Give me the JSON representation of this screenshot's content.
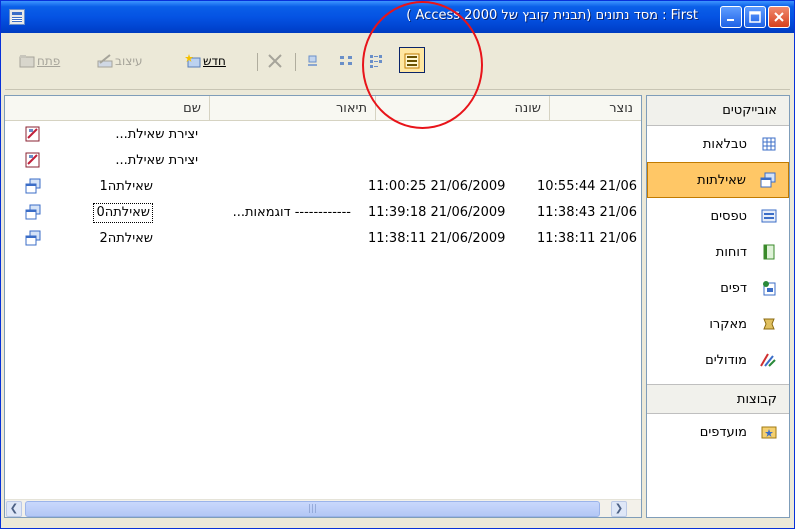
{
  "window": {
    "title": "First : מסד נתונים (תבנית קובץ של Access 2000 )",
    "accent_color": "#0553e3",
    "close_color": "#d7401d"
  },
  "toolbar": {
    "open_label": "פתח",
    "design_label": "עיצוב",
    "new_label": "חדש",
    "delete_icon": "delete-x-icon",
    "view_icons": [
      "large-icons-icon",
      "small-icons-icon",
      "list-view-icon",
      "details-view-icon"
    ],
    "active_view": "details-view-icon"
  },
  "objects_panel": {
    "header": "אובייקטים",
    "items": [
      {
        "label": "טבלאות",
        "icon": "table-icon"
      },
      {
        "label": "שאילתות",
        "icon": "query-icon",
        "selected": true
      },
      {
        "label": "טפסים",
        "icon": "form-icon"
      },
      {
        "label": "דוחות",
        "icon": "report-icon"
      },
      {
        "label": "דפים",
        "icon": "page-icon"
      },
      {
        "label": "מאקרו",
        "icon": "macro-icon"
      },
      {
        "label": "מודולים",
        "icon": "module-icon"
      }
    ],
    "groups_header": "קבוצות",
    "groups": [
      {
        "label": "מועדפים",
        "icon": "favorites-icon"
      }
    ]
  },
  "list": {
    "columns": [
      "שם",
      "תיאור",
      "שונה",
      "נוצר"
    ],
    "rows": [
      {
        "name": "יצירת שאילת...",
        "description": "",
        "modified": "",
        "created": "",
        "icon": "wizard-icon"
      },
      {
        "name": "יצירת שאילת...",
        "description": "",
        "modified": "",
        "created": "",
        "icon": "wizard-icon"
      },
      {
        "name": "שאילתה0",
        "description": "------------ דוגמאות...",
        "modified": "11:39:18 21/06/2009",
        "created": "11:38:43 21/06",
        "icon": "query-icon",
        "focused": true
      },
      {
        "name": "שאילתה1",
        "description": "",
        "modified": "11:00:25 21/06/2009",
        "created": "10:55:44 21/06",
        "icon": "query-icon"
      },
      {
        "name": "שאילתה2",
        "description": "",
        "modified": "11:38:11 21/06/2009",
        "created": "11:38:11 21/06",
        "icon": "query-icon"
      }
    ]
  },
  "annotation": {
    "color": "#e8141a"
  }
}
